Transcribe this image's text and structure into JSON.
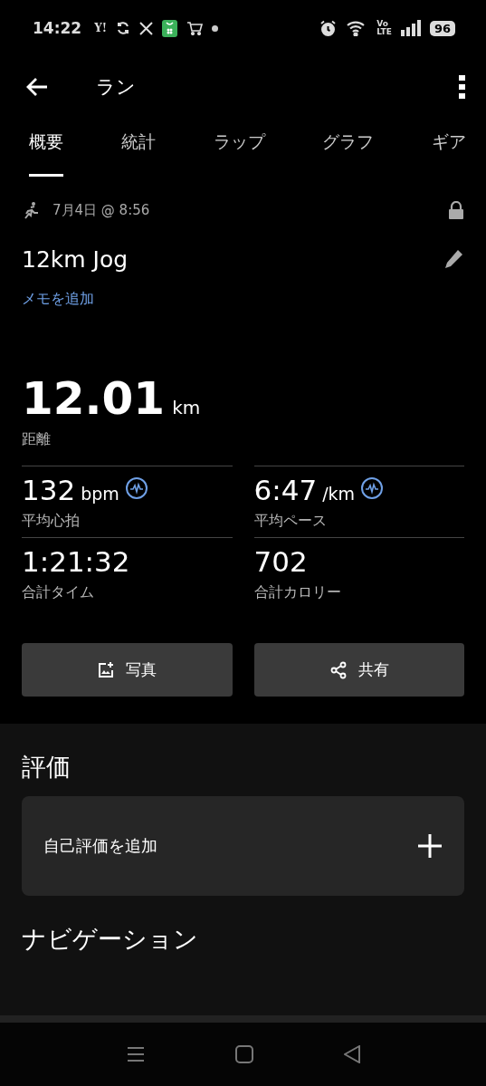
{
  "status_bar": {
    "time": "14:22",
    "app_mark": "Y!",
    "network": [
      "Vo",
      "LTE"
    ],
    "battery": "96"
  },
  "app_bar": {
    "title": "ラン"
  },
  "tabs": [
    {
      "label": "概要",
      "selected": true
    },
    {
      "label": "統計",
      "selected": false
    },
    {
      "label": "ラップ",
      "selected": false
    },
    {
      "label": "グラフ",
      "selected": false
    },
    {
      "label": "ギア",
      "selected": false
    }
  ],
  "activity": {
    "date": "7月4日 @ 8:56",
    "title": "12km Jog",
    "memo_link": "メモを追加"
  },
  "distance": {
    "value": "12.01",
    "unit": "km",
    "label": "距離"
  },
  "stats": [
    {
      "kind": "zone",
      "value": "132",
      "unit": "bpm",
      "label": "平均心拍"
    },
    {
      "kind": "zone",
      "value": "6:47",
      "unit": "/km",
      "label": "平均ペース"
    },
    {
      "kind": "plain",
      "value": "1:21:32",
      "label": "合計タイム"
    },
    {
      "kind": "plain",
      "value": "702",
      "label": "合計カロリー"
    }
  ],
  "buttons": [
    {
      "kind": "photo",
      "label": "写真"
    },
    {
      "kind": "share",
      "label": "共有"
    }
  ],
  "rating": {
    "heading": "評価",
    "add_label": "自己評価を追加"
  },
  "navigation": {
    "heading": "ナビゲーション"
  }
}
